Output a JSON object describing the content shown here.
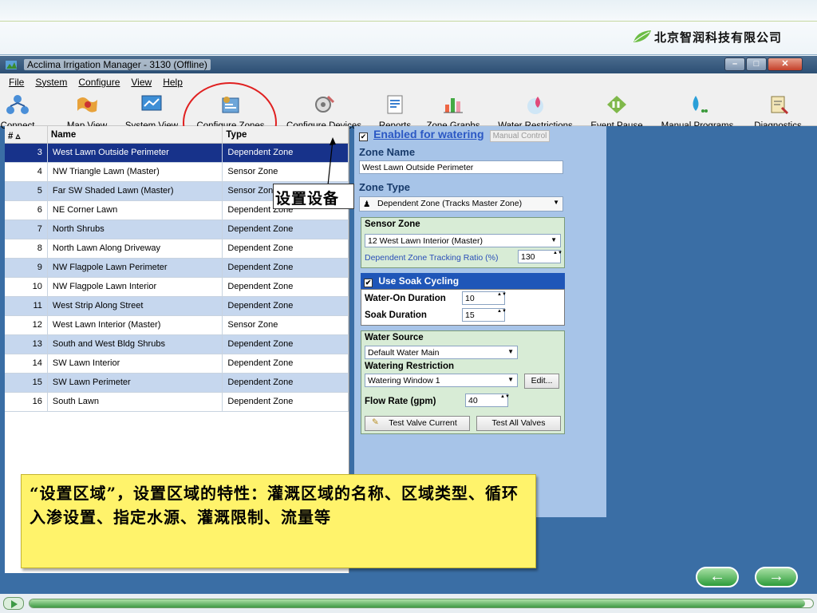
{
  "slide": {
    "brand": "北京智润科技有限公司"
  },
  "window": {
    "title": "Acclima Irrigation Manager - 3130 (Offline)",
    "menus": [
      "File",
      "System",
      "Configure",
      "View",
      "Help"
    ]
  },
  "toolbar": [
    {
      "label": "Connect",
      "icon": "connect-icon"
    },
    {
      "label": "Map View",
      "icon": "map-icon"
    },
    {
      "label": "System View",
      "icon": "system-view-icon"
    },
    {
      "label": "Configure Zones",
      "icon": "configure-zones-icon"
    },
    {
      "label": "Configure Devices",
      "icon": "configure-devices-icon"
    },
    {
      "label": "Reports",
      "icon": "reports-icon"
    },
    {
      "label": "Zone Graphs",
      "icon": "zone-graphs-icon"
    },
    {
      "label": "Water Restrictions",
      "icon": "water-restrictions-icon"
    },
    {
      "label": "Event Pause",
      "icon": "event-pause-icon"
    },
    {
      "label": "Manual Programs",
      "icon": "manual-programs-icon"
    },
    {
      "label": "Diagnostics",
      "icon": "diagnostics-icon"
    }
  ],
  "zones": {
    "columns": [
      "#",
      "Name",
      "Type"
    ],
    "rows": [
      {
        "num": "3",
        "name": "West Lawn Outside Perimeter",
        "type": "Dependent Zone"
      },
      {
        "num": "4",
        "name": "NW Triangle Lawn (Master)",
        "type": "Sensor Zone"
      },
      {
        "num": "5",
        "name": "Far SW Shaded Lawn (Master)",
        "type": "Sensor Zone"
      },
      {
        "num": "6",
        "name": "NE Corner Lawn",
        "type": "Dependent Zone"
      },
      {
        "num": "7",
        "name": "North Shrubs",
        "type": "Dependent Zone"
      },
      {
        "num": "8",
        "name": "North Lawn Along Driveway",
        "type": "Dependent Zone"
      },
      {
        "num": "9",
        "name": "NW Flagpole Lawn Perimeter",
        "type": "Dependent Zone"
      },
      {
        "num": "10",
        "name": "NW Flagpole Lawn Interior",
        "type": "Dependent Zone"
      },
      {
        "num": "11",
        "name": "West Strip Along Street",
        "type": "Dependent Zone"
      },
      {
        "num": "12",
        "name": "West Lawn Interior (Master)",
        "type": "Sensor Zone"
      },
      {
        "num": "13",
        "name": "South and West Bldg Shrubs",
        "type": "Dependent Zone"
      },
      {
        "num": "14",
        "name": "SW Lawn Interior",
        "type": "Dependent Zone"
      },
      {
        "num": "15",
        "name": "SW Lawn Perimeter",
        "type": "Dependent Zone"
      },
      {
        "num": "16",
        "name": "South Lawn",
        "type": "Dependent Zone"
      }
    ]
  },
  "detail": {
    "enabled_label": "Enabled for watering",
    "manual_control": "Manual Control",
    "zone_name_heading": "Zone Name",
    "zone_name_value": "West Lawn Outside Perimeter",
    "zone_type_heading": "Zone Type",
    "zone_type_value": "Dependent Zone (Tracks Master Zone)",
    "sensor_zone_heading": "Sensor Zone",
    "sensor_zone_value": "12 West Lawn Interior (Master)",
    "tracking_label": "Dependent Zone Tracking Ratio (%)",
    "tracking_value": "130",
    "soak_label": "Use Soak Cycling",
    "water_on_label": "Water-On Duration",
    "water_on_value": "10",
    "soak_duration_label": "Soak Duration",
    "soak_duration_value": "15",
    "water_source_heading": "Water Source",
    "water_source_value": "Default Water Main",
    "restriction_heading": "Watering Restriction",
    "restriction_value": "Watering Window 1",
    "edit_label": "Edit...",
    "flow_label": "Flow Rate (gpm)",
    "flow_value": "40",
    "test_current_label": "Test Valve Current",
    "test_all_label": "Test All Valves"
  },
  "annotations": {
    "devices_callout": "设置设备",
    "caption": "“设置区域”，设置区域的特性：灌溉区域的名称、区域类型、循环入渗设置、指定水源、灌溉限制、流量等"
  },
  "nav": {
    "prev": "←",
    "next": "→"
  },
  "progress": {
    "fraction": 0.99
  },
  "colors": {
    "selected_row": "#17328a",
    "alt_row": "#c6d7ee",
    "caption_bg": "#fff36b",
    "panel_bg": "#a7c4e8"
  }
}
